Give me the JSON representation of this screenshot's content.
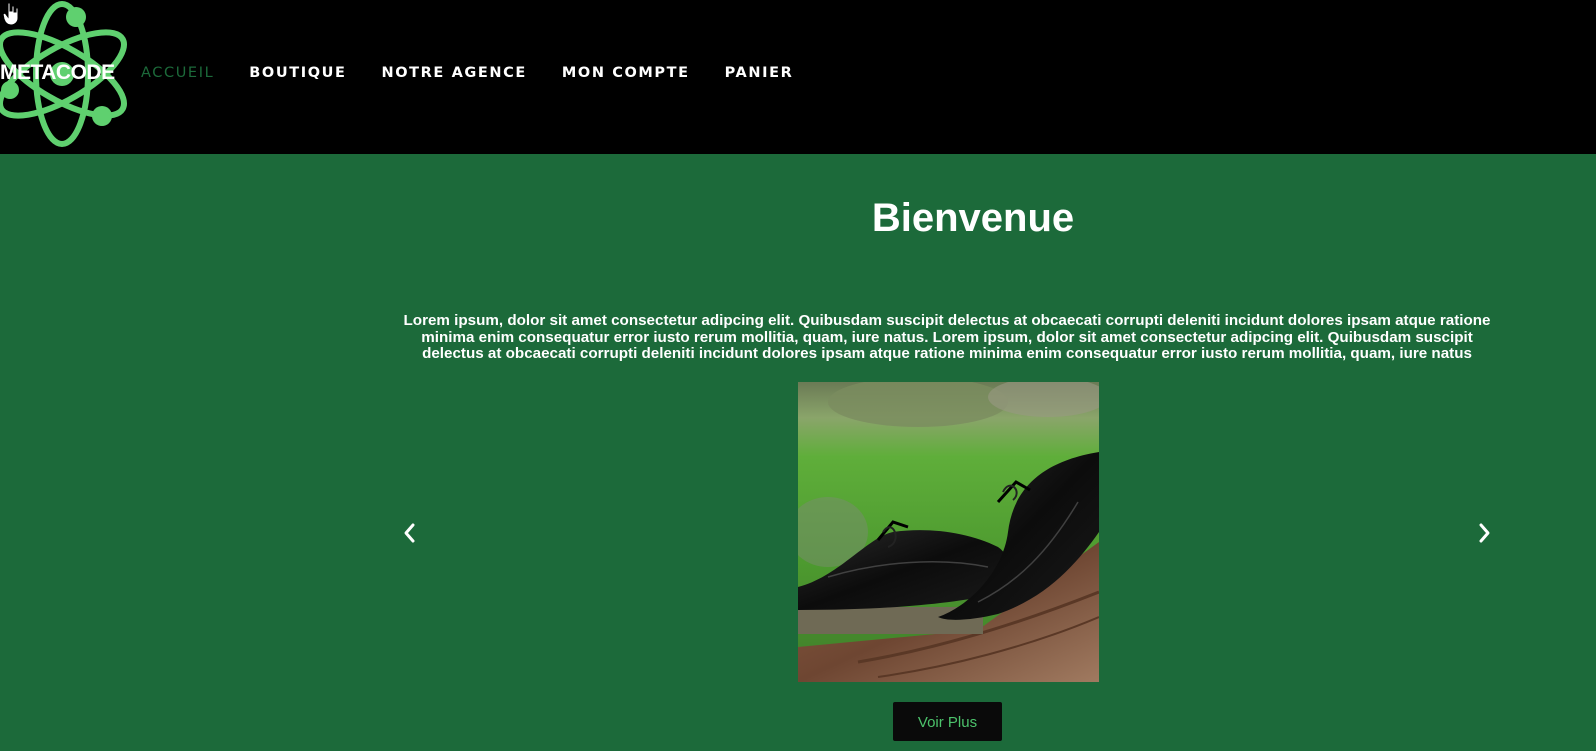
{
  "brand": {
    "name": "METACODE",
    "logo_icon": "atom-logo-icon",
    "accent_color": "#5fd06f"
  },
  "nav": {
    "items": [
      {
        "label": "ACCUEIL",
        "active": true
      },
      {
        "label": "BOUTIQUE",
        "active": false
      },
      {
        "label": "NOTRE AGENCE",
        "active": false
      },
      {
        "label": "MON COMPTE",
        "active": false
      },
      {
        "label": "PANIER",
        "active": false
      }
    ]
  },
  "hero": {
    "title": "Bienvenue",
    "text": "Lorem ipsum, dolor sit amet consectetur adipcing elit. Quibusdam suscipit delectus at obcaecati corrupti deleniti incidunt dolores ipsam atque ratione minima enim consequatur error iusto rerum mollitia, quam, iure natus. Lorem ipsum, dolor sit amet consectetur adipcing elit. Quibusdam suscipit delectus at obcaecati corrupti deleniti incidunt dolores ipsam atque ratione minima enim consequatur error iusto rerum mollitia, quam, iure natus"
  },
  "carousel": {
    "prev_icon": "chevron-left-icon",
    "next_icon": "chevron-right-icon",
    "image_subject": "black leather shoes on wooden log in garden"
  },
  "cta": {
    "label": "Voir Plus"
  },
  "colors": {
    "navbar_bg": "#000000",
    "page_bg": "#1c6a3a",
    "active_nav": "#1c6a3a",
    "button_bg": "#0a0a0a",
    "button_text": "#4cc26b"
  }
}
